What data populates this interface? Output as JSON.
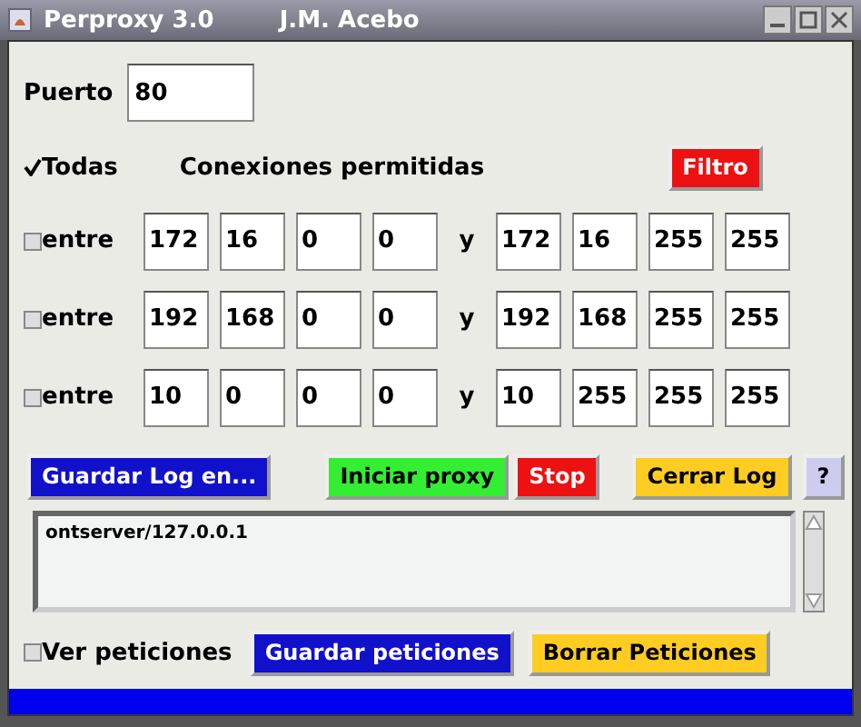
{
  "window": {
    "title": "Perproxy 3.0",
    "author": "J.M. Acebo"
  },
  "port": {
    "label": "Puerto",
    "value": "80"
  },
  "all_checkbox": {
    "label": "Todas",
    "checked": true
  },
  "section_label": "Conexiones permitidas",
  "filter_button": {
    "label": "Filtro",
    "color": "#ee1111"
  },
  "ranges": [
    {
      "checked": false,
      "label": "entre",
      "from": [
        "172",
        "16",
        "0",
        "0"
      ],
      "separator": "y",
      "to": [
        "172",
        "16",
        "255",
        "255"
      ]
    },
    {
      "checked": false,
      "label": "entre",
      "from": [
        "192",
        "168",
        "0",
        "0"
      ],
      "separator": "y",
      "to": [
        "192",
        "168",
        "255",
        "255"
      ]
    },
    {
      "checked": false,
      "label": "entre",
      "from": [
        "10",
        "0",
        "0",
        "0"
      ],
      "separator": "y",
      "to": [
        "10",
        "255",
        "255",
        "255"
      ]
    }
  ],
  "action_buttons": [
    {
      "label": "Guardar Log en...",
      "color": "#1111cc"
    },
    {
      "label": "Iniciar proxy",
      "color": "#33ee33"
    },
    {
      "label": "Stop",
      "color": "#ee1111"
    },
    {
      "label": "Cerrar Log",
      "color": "#ffcc22"
    },
    {
      "label": "?",
      "color": "#ccccee"
    }
  ],
  "log": {
    "text": "ontserver/127.0.0.1"
  },
  "requests_checkbox": {
    "label": "Ver peticiones",
    "checked": false
  },
  "bottom_buttons": [
    {
      "label": "Guardar peticiones",
      "color": "#1111cc"
    },
    {
      "label": "Borrar Peticiones",
      "color": "#ffcc22"
    }
  ],
  "status_bar": {
    "color": "#0000ee"
  }
}
